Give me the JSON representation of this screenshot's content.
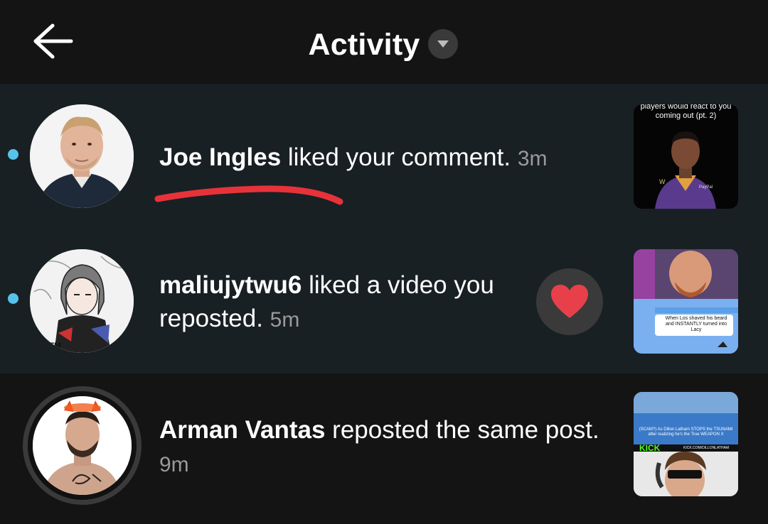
{
  "header": {
    "back_icon": "arrow-left-icon",
    "title": "Activity",
    "dropdown_icon": "caret-down-icon"
  },
  "activities": [
    {
      "unread": true,
      "name": "Joe Ingles",
      "action": "liked your comment.",
      "time": "3m",
      "thumbnail_caption": "players would react to you coming out (pt. 2)"
    },
    {
      "unread": true,
      "name": "maliujytwu6",
      "action_line1": "liked a video you",
      "action_line2": "reposted.",
      "time": "5m",
      "reaction_icon": "heart-icon",
      "thumbnail_caption": "When Los shaved his beard and INSTANTLY turned into Lacy"
    },
    {
      "unread": false,
      "name": "Arman Vantas",
      "action": "reposted the same post.",
      "time": "9m",
      "thumbnail_caption": "(SCAM?) As Dillon Latham STOPS the TSUNAMI after realizing he's the True WEAPON X",
      "thumbnail_badge": "KICK",
      "thumbnail_subbadge": "KICK.COM/DILLONLATHAM"
    }
  ],
  "colors": {
    "background": "#141414",
    "unread_row": "#182024",
    "unread_dot": "#56c3ea",
    "secondary_text": "#9a9a9a",
    "heart": "#e8404a",
    "annotation": "#e8323a"
  }
}
